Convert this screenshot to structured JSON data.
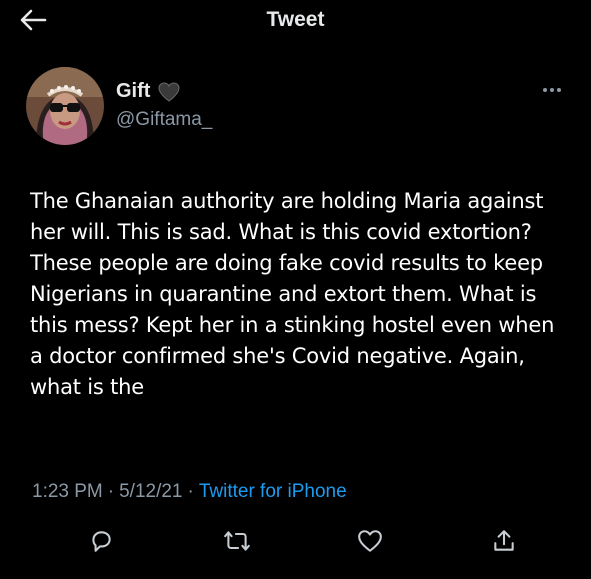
{
  "header": {
    "title": "Tweet",
    "back_icon": "arrow-left-icon"
  },
  "author": {
    "name": "Gift",
    "name_emoji": "black-heart-icon",
    "handle": "@Giftama_"
  },
  "tweet": {
    "text": "The Ghanaian authority are holding Maria against her will. This is sad. What is this covid extortion? These people are doing fake covid results to keep Nigerians in quarantine and extort them. What is this mess? Kept her in a stinking hostel even when a doctor confirmed she's Covid negative. Again, what is the"
  },
  "meta": {
    "time": "1:23 PM",
    "separator": "·",
    "date": "5/12/21",
    "source": "Twitter for iPhone"
  },
  "actions": {
    "icons": [
      "reply-icon",
      "retweet-icon",
      "like-icon",
      "share-icon"
    ]
  },
  "colors": {
    "background": "#000000",
    "text": "#e7e9ea",
    "secondary": "#8b98a5",
    "accent": "#1d9bf0"
  }
}
